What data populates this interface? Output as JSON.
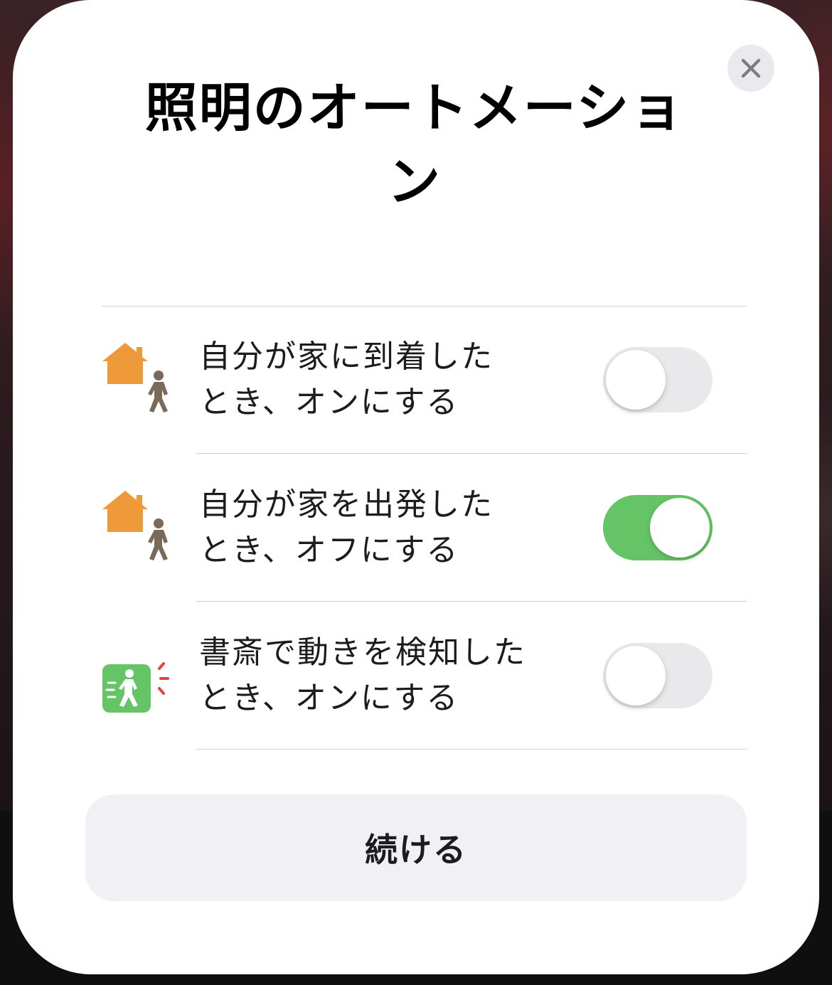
{
  "sheet": {
    "title": "照明のオートメーション",
    "close_icon": "xmark-icon"
  },
  "automations": [
    {
      "line1": "自分が家に到着した",
      "line2": "とき、オンにする",
      "icon": "home-arrive-person-icon",
      "enabled": false
    },
    {
      "line1": "自分が家を出発した",
      "line2": "とき、オフにする",
      "icon": "home-leave-person-icon",
      "enabled": true
    },
    {
      "line1": "書斎で動きを検知した",
      "line2": "とき、オンにする",
      "icon": "motion-sensor-icon",
      "enabled": false
    }
  ],
  "footer": {
    "continue_label": "続ける"
  },
  "colors": {
    "accent_on": "#65c466",
    "toggle_off": "#e9e9eb",
    "home_orange": "#ee9a3a",
    "person_brown": "#7a6a5a",
    "motion_green": "#65c466",
    "motion_red": "#e0463c",
    "button_bg": "#f0f0f5"
  }
}
